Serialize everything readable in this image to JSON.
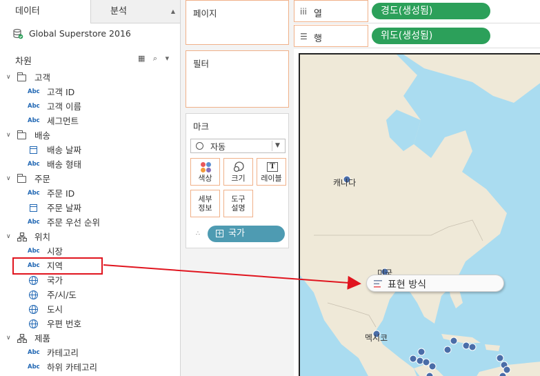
{
  "left_pane": {
    "tabs": [
      {
        "label": "데이터"
      },
      {
        "label": "분석"
      }
    ],
    "data_source": "Global Superstore 2016",
    "dimensions_header": "차원",
    "groups": [
      {
        "label": "고객",
        "fields": [
          "고객 ID",
          "고객 이름",
          "세그먼트"
        ]
      },
      {
        "label": "배송",
        "fields": [
          "배송 날짜",
          "배송 형태"
        ]
      },
      {
        "label": "주문",
        "fields": [
          "주문 ID",
          "주문 날짜",
          "주문 우선 순위"
        ]
      },
      {
        "label": "위치",
        "fields": [
          "시장",
          "지역",
          "국가",
          "주/시/도",
          "도시",
          "우편 번호"
        ]
      },
      {
        "label": "제품",
        "fields": [
          "카테고리",
          "하위 카테고리"
        ]
      }
    ],
    "type_badge": "Abc"
  },
  "cards": {
    "pages": "페이지",
    "filters": "필터",
    "marks": "마크",
    "mark_type": "자동",
    "buttons": {
      "color": "색상",
      "size": "크기",
      "label": "레이블",
      "label_icon": "T",
      "detail": "세부\n정보",
      "tooltip": "도구\n설명"
    },
    "country_pill": "국가",
    "country_pill_icon": "+"
  },
  "shelves": {
    "columns": {
      "icon": "iii",
      "label": "열",
      "pill": "경도(생성됨)"
    },
    "rows": {
      "icon": "☰",
      "label": "행",
      "pill": "위도(생성됨)"
    }
  },
  "map": {
    "labels": [
      {
        "key": "canada",
        "text": "캐나다"
      },
      {
        "key": "usa",
        "text": "미국"
      },
      {
        "key": "mexico",
        "text": "멕시코"
      }
    ]
  },
  "drag": {
    "ghost_label": "표현 방식"
  },
  "colors": {
    "accent_orange": "#f0b088",
    "pill_green": "#2ca05a",
    "pill_blue": "#4e9bb2",
    "highlight_red": "#e0141e",
    "map_water": "#aadcf0",
    "map_land": "#efe9d8",
    "map_dot": "#4a6da8"
  }
}
